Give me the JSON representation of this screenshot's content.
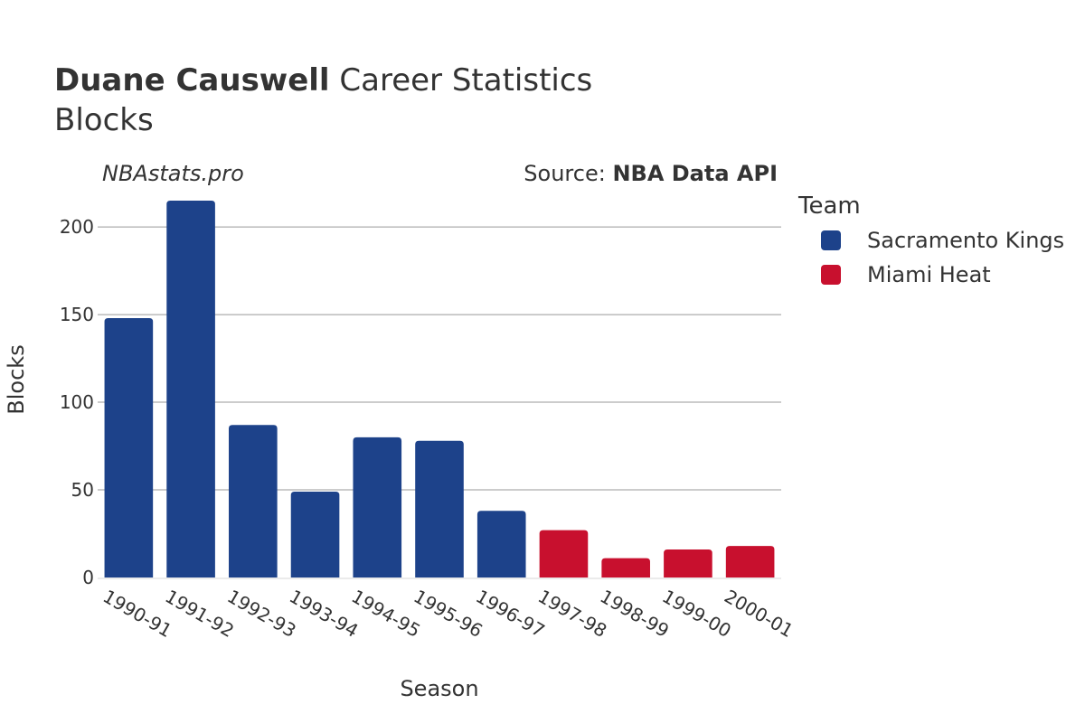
{
  "header": {
    "player_name": "Duane Causwell",
    "title_suffix": " Career Statistics",
    "subtitle": "Blocks",
    "watermark": "NBAstats.pro",
    "source_prefix": "Source: ",
    "source_name": "NBA Data API"
  },
  "colors": {
    "Sacramento Kings": "#1d428a",
    "Miami Heat": "#c8102e",
    "text": "#333333",
    "grid": "#999999"
  },
  "chart_data": {
    "type": "bar",
    "title": "Duane Causwell Career Statistics",
    "subtitle": "Blocks",
    "xlabel": "Season",
    "ylabel": "Blocks",
    "ylim": [
      0,
      215
    ],
    "yticks": [
      0,
      50,
      100,
      150,
      200
    ],
    "grid": true,
    "legend": {
      "title": "Team",
      "placement": "right",
      "entries": [
        "Sacramento Kings",
        "Miami Heat"
      ]
    },
    "categories": [
      "1990-91",
      "1991-92",
      "1992-93",
      "1993-94",
      "1994-95",
      "1995-96",
      "1996-97",
      "1997-98",
      "1998-99",
      "1999-00",
      "2000-01"
    ],
    "teams": [
      "Sacramento Kings",
      "Sacramento Kings",
      "Sacramento Kings",
      "Sacramento Kings",
      "Sacramento Kings",
      "Sacramento Kings",
      "Sacramento Kings",
      "Miami Heat",
      "Miami Heat",
      "Miami Heat",
      "Miami Heat"
    ],
    "values": [
      148,
      215,
      87,
      49,
      80,
      78,
      38,
      27,
      11,
      16,
      18
    ],
    "series": [
      {
        "name": "Sacramento Kings",
        "categories": [
          "1990-91",
          "1991-92",
          "1992-93",
          "1993-94",
          "1994-95",
          "1995-96",
          "1996-97"
        ],
        "values": [
          148,
          215,
          87,
          49,
          80,
          78,
          38
        ]
      },
      {
        "name": "Miami Heat",
        "categories": [
          "1997-98",
          "1998-99",
          "1999-00",
          "2000-01"
        ],
        "values": [
          27,
          11,
          16,
          18
        ]
      }
    ]
  }
}
